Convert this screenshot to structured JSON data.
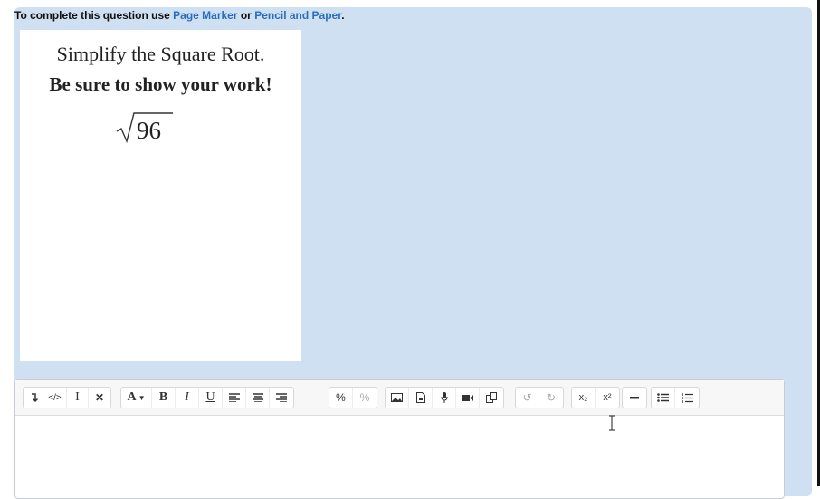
{
  "instruction": {
    "prefix": "To complete this question use ",
    "link1": "Page Marker",
    "middle": " or ",
    "link2": "Pencil and Paper",
    "suffix": "."
  },
  "question": {
    "title": "Simplify the Square Root.",
    "subtitle": "Be sure to show your work!",
    "radicand": "96"
  },
  "toolbar": {
    "font_label": "A",
    "bold": "B",
    "italic": "I",
    "underline": "U",
    "subscript": "x₂",
    "superscript": "x²"
  },
  "editor": {
    "content": ""
  },
  "colors": {
    "panel": "#cfe0f2",
    "link": "#2a6ebb"
  }
}
